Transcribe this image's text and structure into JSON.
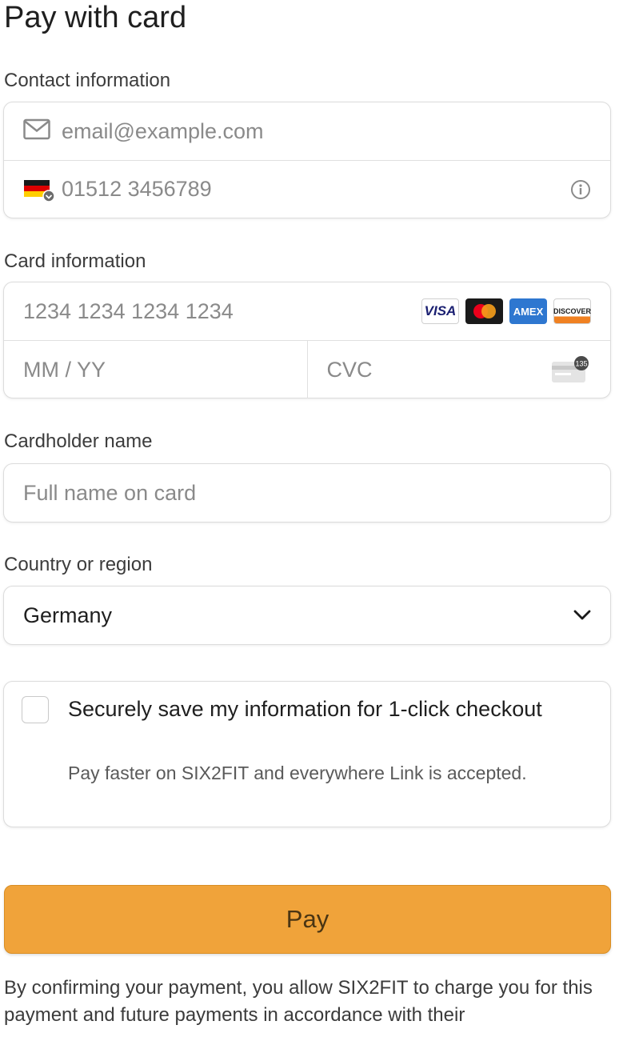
{
  "title": "Pay with card",
  "contact": {
    "label": "Contact information",
    "email_placeholder": "email@example.com",
    "phone_placeholder": "01512 3456789"
  },
  "card": {
    "label": "Card information",
    "number_placeholder": "1234 1234 1234 1234",
    "expiry_placeholder": "MM / YY",
    "cvc_placeholder": "CVC",
    "brands": [
      "VISA",
      "Mastercard",
      "AMEX",
      "DISCOVER"
    ],
    "cvc_hint": "135"
  },
  "cardholder": {
    "label": "Cardholder name",
    "placeholder": "Full name on card"
  },
  "country": {
    "label": "Country or region",
    "selected": "Germany"
  },
  "save_info": {
    "title": "Securely save my information for 1-click checkout",
    "subtitle": "Pay faster on SIX2FIT and everywhere Link is accepted."
  },
  "pay_button": "Pay",
  "legal": "By confirming your payment, you allow SIX2FIT to charge you for this payment and future payments in accordance with their",
  "colors": {
    "pay_button": "#f0a33a",
    "border": "#dcdcdc"
  }
}
